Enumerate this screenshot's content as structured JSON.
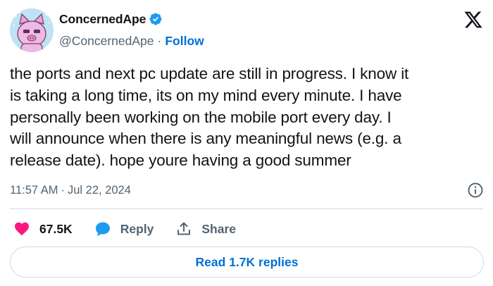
{
  "author": {
    "display_name": "ConcernedApe",
    "handle": "@ConcernedApe",
    "separator": "·",
    "follow_label": "Follow",
    "verified": true,
    "avatar_icon": "pink-cartoon-pig-avatar",
    "verified_color": "#1d9bf0"
  },
  "platform_icon": "x-logo",
  "tweet": {
    "text": "the ports and next pc update are still in progress. I know it\nis taking a long time, its on my mind every minute. I have\npersonally been working on the mobile port every day. I\nwill announce when there is any meaningful news (e.g. a\nrelease date). hope youre having a good summer",
    "time": "11:57 AM",
    "date_separator": "·",
    "date": "Jul 22, 2024"
  },
  "actions": {
    "like_count": "67.5K",
    "reply_label": "Reply",
    "share_label": "Share",
    "like_color": "#f91880",
    "reply_color": "#1d9bf0"
  },
  "read_replies_label": "Read 1.7K replies",
  "colors": {
    "link": "#006fd6",
    "secondary_text": "#536471",
    "border": "#cfd9de"
  }
}
